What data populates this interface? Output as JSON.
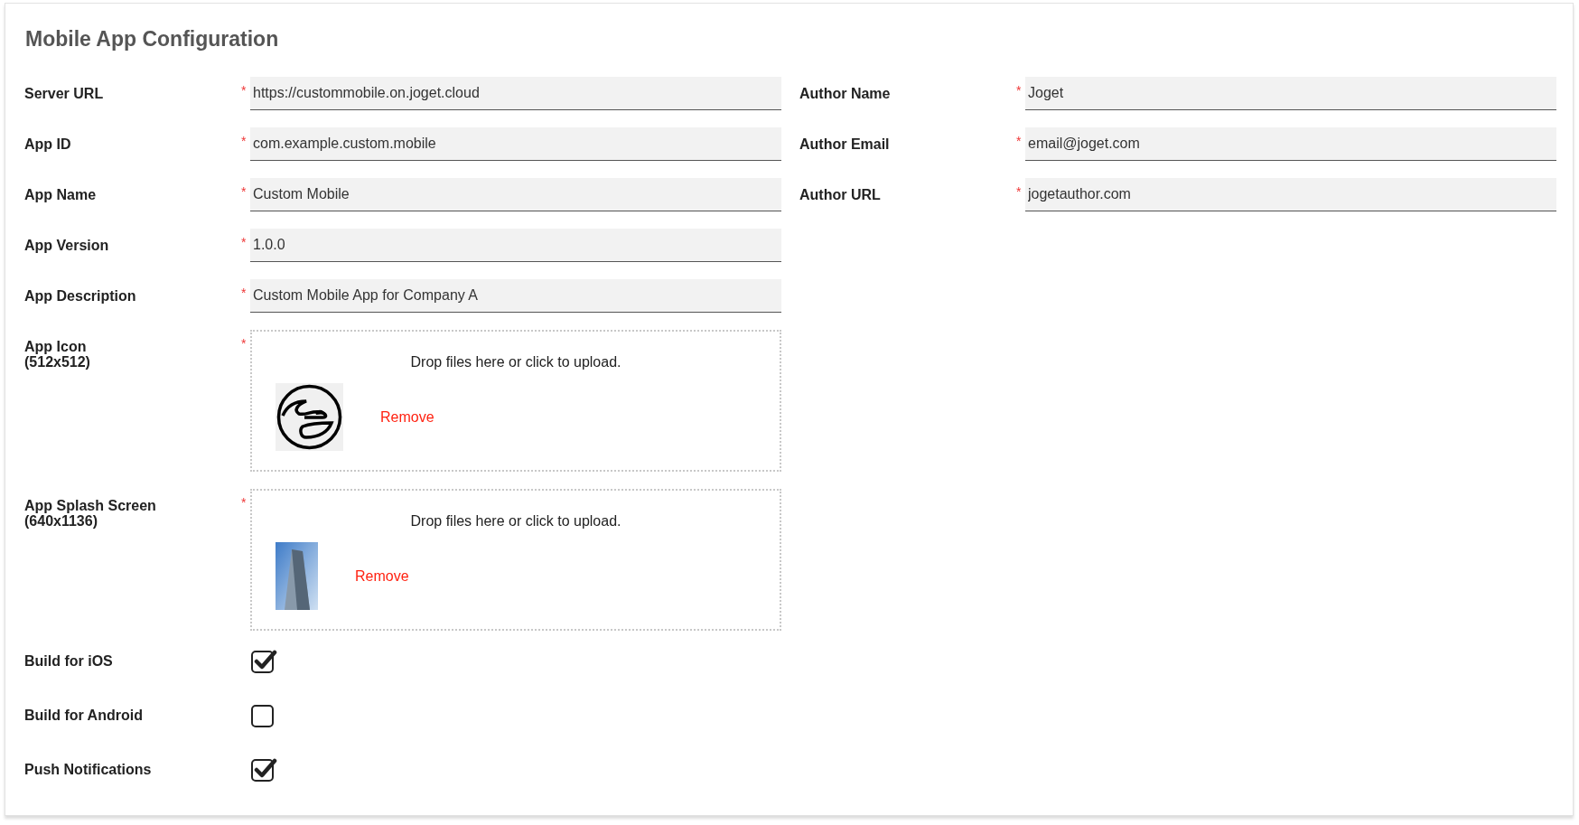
{
  "title": "Mobile App Configuration",
  "left_fields": [
    {
      "kind": "text",
      "label": "Server URL",
      "required_mark": "*",
      "value": "https://custommobile.on.joget.cloud"
    },
    {
      "kind": "text",
      "label": "App ID",
      "required_mark": "*",
      "value": "com.example.custom.mobile"
    },
    {
      "kind": "text",
      "label": "App Name",
      "required_mark": "*",
      "value": "Custom Mobile"
    },
    {
      "kind": "text",
      "label": "App Version",
      "required_mark": "*",
      "value": "1.0.0"
    },
    {
      "kind": "text",
      "label": "App Description",
      "required_mark": "*",
      "value": "Custom Mobile App for Company A"
    },
    {
      "kind": "upload_logo",
      "label": "App Icon",
      "size": "(512x512)",
      "required_mark": "*",
      "hint": "Drop files here or click to upload.",
      "remove": "Remove"
    },
    {
      "kind": "upload_photo",
      "label": "App Splash Screen",
      "size": "(640x1136)",
      "required_mark": "*",
      "hint": "Drop files here or click to upload.",
      "remove": "Remove"
    },
    {
      "kind": "checkbox",
      "label": "Build for iOS",
      "checked": true
    },
    {
      "kind": "checkbox",
      "label": "Build for Android",
      "checked": false
    },
    {
      "kind": "checkbox",
      "label": "Push Notifications",
      "checked": true
    }
  ],
  "right_fields": [
    {
      "kind": "text",
      "label": "Author Name",
      "required_mark": "*",
      "value": "Joget"
    },
    {
      "kind": "text",
      "label": "Author Email",
      "required_mark": "*",
      "value": "email@joget.com"
    },
    {
      "kind": "text",
      "label": "Author URL",
      "required_mark": "*",
      "value": "jogetauthor.com"
    }
  ]
}
